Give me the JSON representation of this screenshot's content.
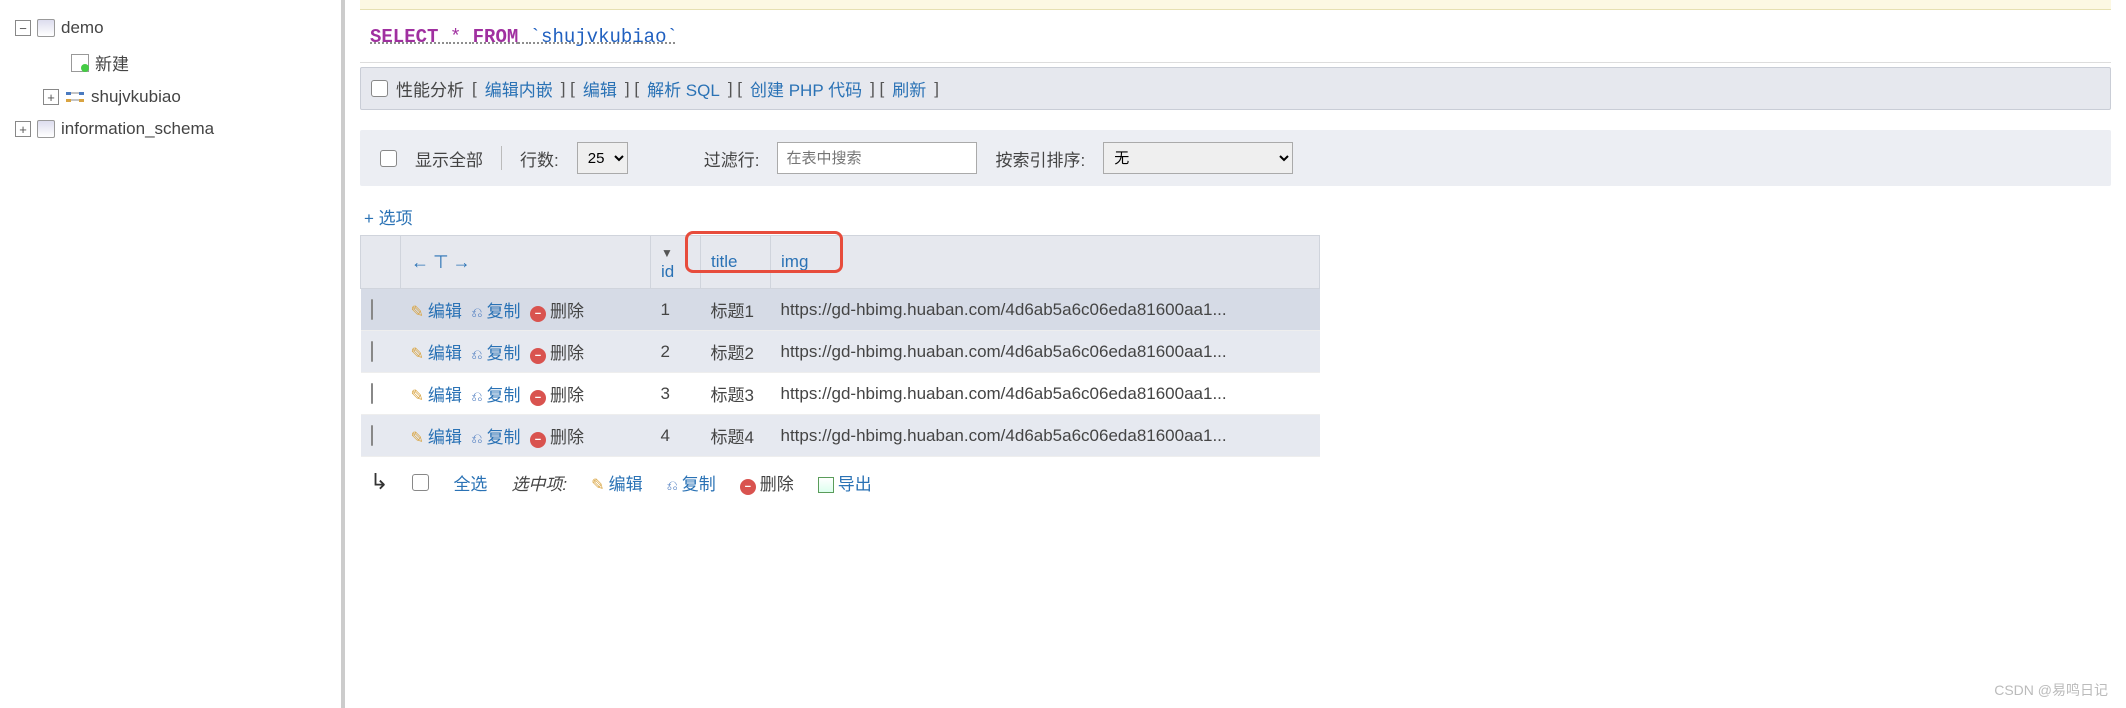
{
  "sidebar": {
    "db1": "demo",
    "new_item": "新建",
    "table1": "shujvkubiao",
    "db2": "information_schema"
  },
  "sql": {
    "select": "SELECT",
    "star": "*",
    "from": "FROM",
    "table": "`shujvkubiao`"
  },
  "profiling": {
    "label": "性能分析",
    "edit_inline": "编辑内嵌",
    "edit": "编辑",
    "explain": "解析 SQL",
    "create_php": "创建 PHP 代码",
    "refresh": "刷新"
  },
  "toolbar": {
    "show_all": "显示全部",
    "rows_label": "行数:",
    "rows_value": "25",
    "filter_label": "过滤行:",
    "filter_placeholder": "在表中搜索",
    "sort_label": "按索引排序:",
    "sort_value": "无"
  },
  "options_label": "+ 选项",
  "columns": {
    "id": "id",
    "title": "title",
    "img": "img"
  },
  "actions": {
    "edit": "编辑",
    "copy": "复制",
    "delete": "删除"
  },
  "rows": [
    {
      "id": "1",
      "title": "标题1",
      "img": "https://gd-hbimg.huaban.com/4d6ab5a6c06eda81600aa1..."
    },
    {
      "id": "2",
      "title": "标题2",
      "img": "https://gd-hbimg.huaban.com/4d6ab5a6c06eda81600aa1..."
    },
    {
      "id": "3",
      "title": "标题3",
      "img": "https://gd-hbimg.huaban.com/4d6ab5a6c06eda81600aa1..."
    },
    {
      "id": "4",
      "title": "标题4",
      "img": "https://gd-hbimg.huaban.com/4d6ab5a6c06eda81600aa1..."
    }
  ],
  "footer": {
    "check_all": "全选",
    "with_selected": "选中项:",
    "edit": "编辑",
    "copy": "复制",
    "delete": "删除",
    "export": "导出"
  },
  "watermark": "CSDN @易鸣日记"
}
